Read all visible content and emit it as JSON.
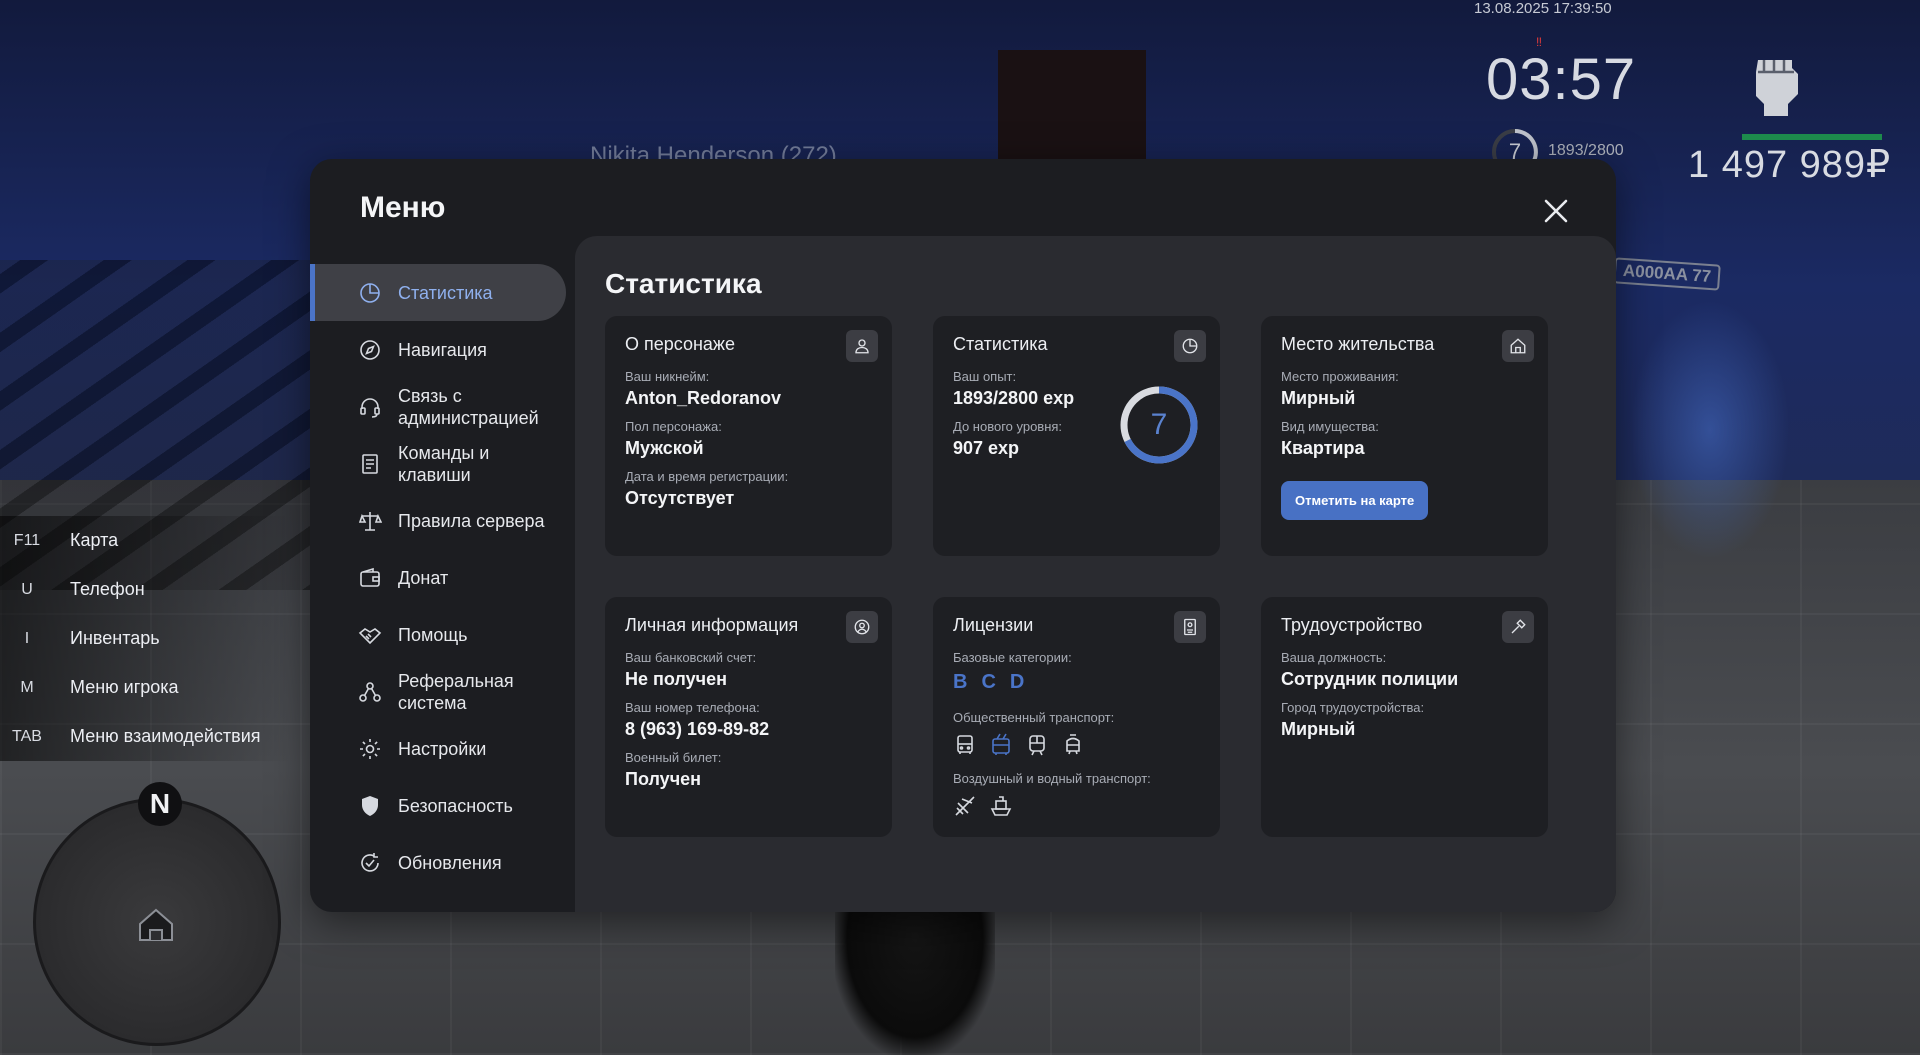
{
  "hud": {
    "datetime": "13.08.2025 17:39:50",
    "timer": "03:57",
    "level": "7",
    "exp": "1893/2800",
    "money": "1 497 989₽",
    "nametag": "Nikita Henderson (272)",
    "plate": "A000AA 77"
  },
  "hints": [
    {
      "key": "F11",
      "label": "Карта"
    },
    {
      "key": "U",
      "label": "Телефон"
    },
    {
      "key": "I",
      "label": "Инвентарь"
    },
    {
      "key": "M",
      "label": "Меню игрока"
    },
    {
      "key": "TAB",
      "label": "Меню взаимодействия"
    }
  ],
  "minimap": {
    "north": "N"
  },
  "menu": {
    "title": "Меню",
    "nav": [
      {
        "label": "Статистика",
        "icon": "chart-pie-icon"
      },
      {
        "label": "Навигация",
        "icon": "compass-icon"
      },
      {
        "label": "Связь с администрацией",
        "icon": "headset-icon"
      },
      {
        "label": "Команды и клавиши",
        "icon": "document-icon"
      },
      {
        "label": "Правила сервера",
        "icon": "scales-icon"
      },
      {
        "label": "Донат",
        "icon": "wallet-icon"
      },
      {
        "label": "Помощь",
        "icon": "handshake-icon"
      },
      {
        "label": "Реферальная система",
        "icon": "referral-icon"
      },
      {
        "label": "Настройки",
        "icon": "gear-icon"
      },
      {
        "label": "Безопасность",
        "icon": "shield-icon"
      },
      {
        "label": "Обновления",
        "icon": "refresh-check-icon"
      }
    ]
  },
  "stats": {
    "title": "Статистика",
    "character": {
      "title": "О персонаже",
      "nick_label": "Ваш никнейм:",
      "nick": "Anton_Redoranov",
      "gender_label": "Пол персонажа:",
      "gender": "Мужской",
      "reg_label": "Дата и время регистрации:",
      "reg": "Отсутствует"
    },
    "statistics": {
      "title": "Статистика",
      "exp_label": "Ваш опыт:",
      "exp": "1893/2800 exp",
      "next_label": "До нового уровня:",
      "next": "907 exp",
      "level": "7",
      "progress": 0.676
    },
    "residence": {
      "title": "Место жительства",
      "place_label": "Место проживания:",
      "place": "Мирный",
      "property_label": "Вид имущества:",
      "property": "Квартира",
      "button": "Отметить на карте"
    },
    "personal": {
      "title": "Личная информация",
      "bank_label": "Ваш банковский счет:",
      "bank": "Не получен",
      "phone_label": "Ваш номер телефона:",
      "phone": "8 (963) 169-89-82",
      "military_label": "Военный билет:",
      "military": "Получен"
    },
    "licenses": {
      "title": "Лицензии",
      "base_label": "Базовые категории:",
      "base": [
        "B",
        "C",
        "D"
      ],
      "public_label": "Общественный транспорт:",
      "air_label": "Воздушный и водный транспорт:"
    },
    "employment": {
      "title": "Трудоустройство",
      "position_label": "Ваша должность:",
      "position": "Сотрудник полиции",
      "city_label": "Город трудоустройства:",
      "city": "Мирный"
    }
  },
  "colors": {
    "accent": "#4871c4",
    "panel": "#1c1d21",
    "card": "#1e1f23"
  }
}
